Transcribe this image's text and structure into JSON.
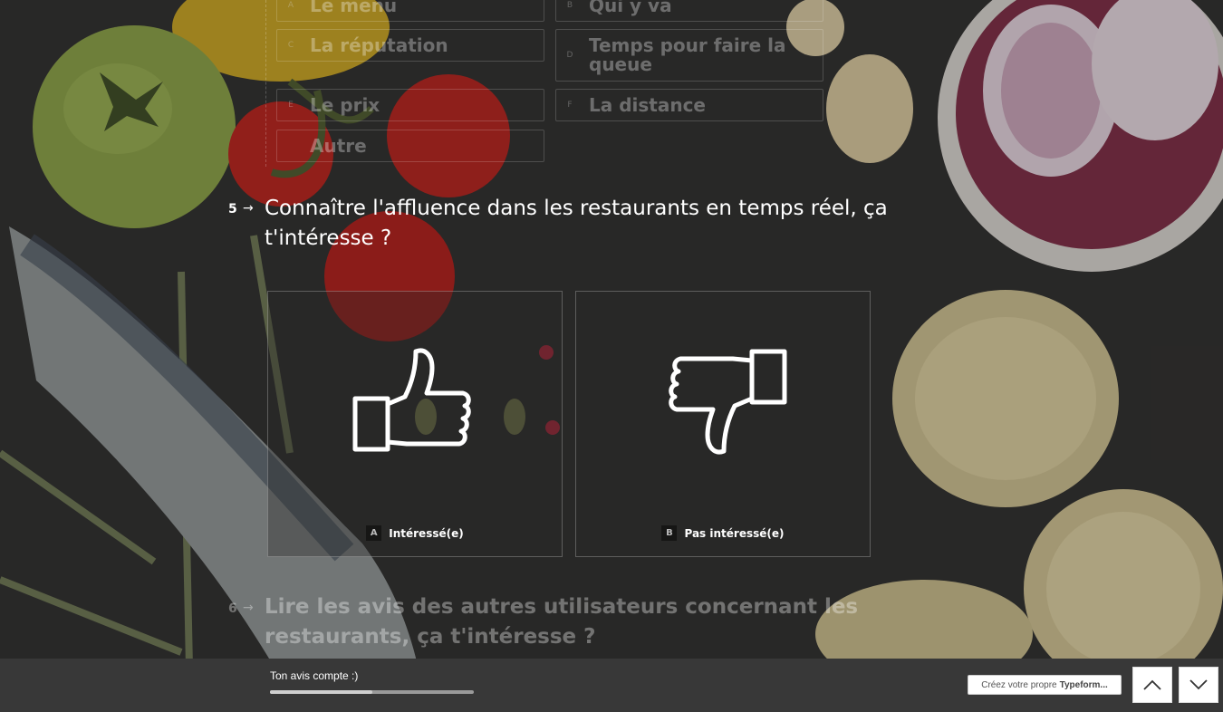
{
  "previous_question": {
    "options": [
      {
        "key": "A",
        "label": "Le menu"
      },
      {
        "key": "B",
        "label": "Qui y va"
      },
      {
        "key": "C",
        "label": "La réputation"
      },
      {
        "key": "D",
        "label": "Temps pour faire la queue"
      },
      {
        "key": "E",
        "label": "Le prix"
      },
      {
        "key": "F",
        "label": "La distance"
      },
      {
        "key": "",
        "label": "Autre"
      }
    ]
  },
  "current_question": {
    "number": "5",
    "arrow": "→",
    "text": "Connaître l'affluence dans les restaurants en temps réel, ça t'intéresse ?",
    "choices": [
      {
        "key": "A",
        "label": "Intéressé(e)",
        "icon": "thumbs-up-icon"
      },
      {
        "key": "B",
        "label": "Pas intéressé(e)",
        "icon": "thumbs-down-icon"
      }
    ]
  },
  "next_question": {
    "number": "6",
    "arrow": "→",
    "text": "Lire les avis des autres utilisateurs concernant les restaurants, ça t'intéresse ?"
  },
  "footer": {
    "progress_label": "Ton avis compte :)",
    "progress_value": 0.5,
    "brand_prefix": "Créez votre propre",
    "brand_name": "Typeform...",
    "up_icon": "chevron-up-icon",
    "down_icon": "chevron-down-icon"
  }
}
